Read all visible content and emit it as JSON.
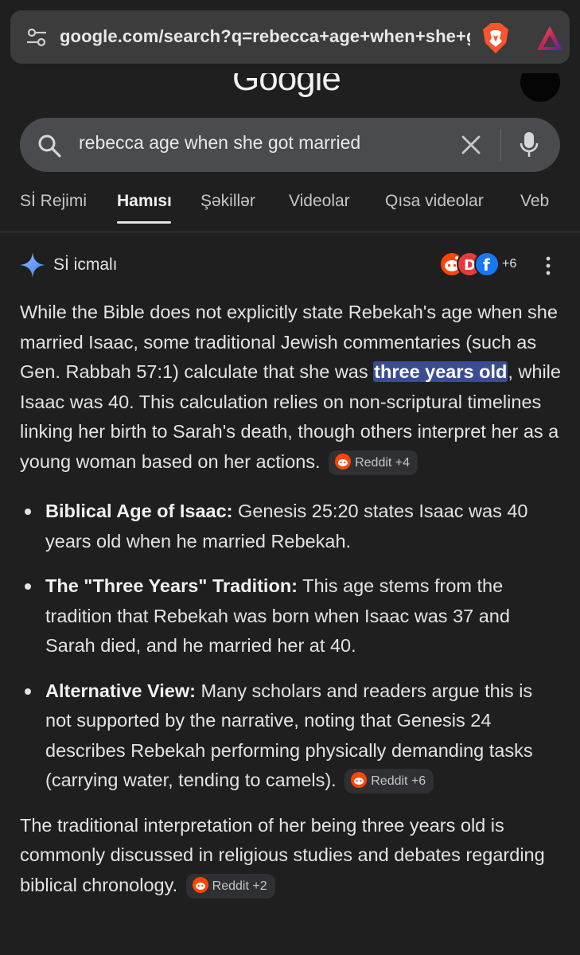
{
  "browser": {
    "url": "google.com/search?q=rebecca+age+when+she+got+married"
  },
  "google": {
    "logo": "Google"
  },
  "search": {
    "query": "rebecca age when she got married"
  },
  "tabs": [
    {
      "label": "Sİ Rejimi"
    },
    {
      "label": "Hamısı"
    },
    {
      "label": "Şəkillər"
    },
    {
      "label": "Videolar"
    },
    {
      "label": "Qısa videolar"
    },
    {
      "label": "Veb"
    }
  ],
  "ai_overview": {
    "title": "Sİ icmalı",
    "more_sources": "+6",
    "intro": {
      "before": "While the Bible does not explicitly state Rebekah's age when she married Isaac, some traditional Jewish commentaries (such as Gen. Rabbah 57:1) calculate that she was ",
      "highlight": "three years old",
      "after": ", while Isaac was 40. This calculation relies on non-scriptural timelines linking her birth to Sarah's death, though others interpret her as a young woman based on her actions.",
      "chip": "Reddit +4"
    },
    "bullets": [
      {
        "title": "Biblical Age of Isaac:",
        "text": " Genesis 25:20 states Isaac was 40 years old when he married Rebekah.",
        "chip": ""
      },
      {
        "title": "The \"Three Years\" Tradition:",
        "text": " This age stems from the tradition that Rebekah was born when Isaac was 37 and Sarah died, and he married her at 40.",
        "chip": ""
      },
      {
        "title": "Alternative View:",
        "text": " Many scholars and readers argue this is not supported by the narrative, noting that Genesis 24 describes Rebekah performing physically demanding tasks (carrying water, tending to camels).",
        "chip": "Reddit +6"
      }
    ],
    "closing": {
      "text": "The traditional interpretation of her being three years old is commonly discussed in religious studies and debates regarding biblical chronology.",
      "chip": "Reddit +2"
    }
  },
  "colors": {
    "background": "#1f1f1f",
    "highlight": "#3b4d91",
    "reddit": "#ff4500"
  }
}
